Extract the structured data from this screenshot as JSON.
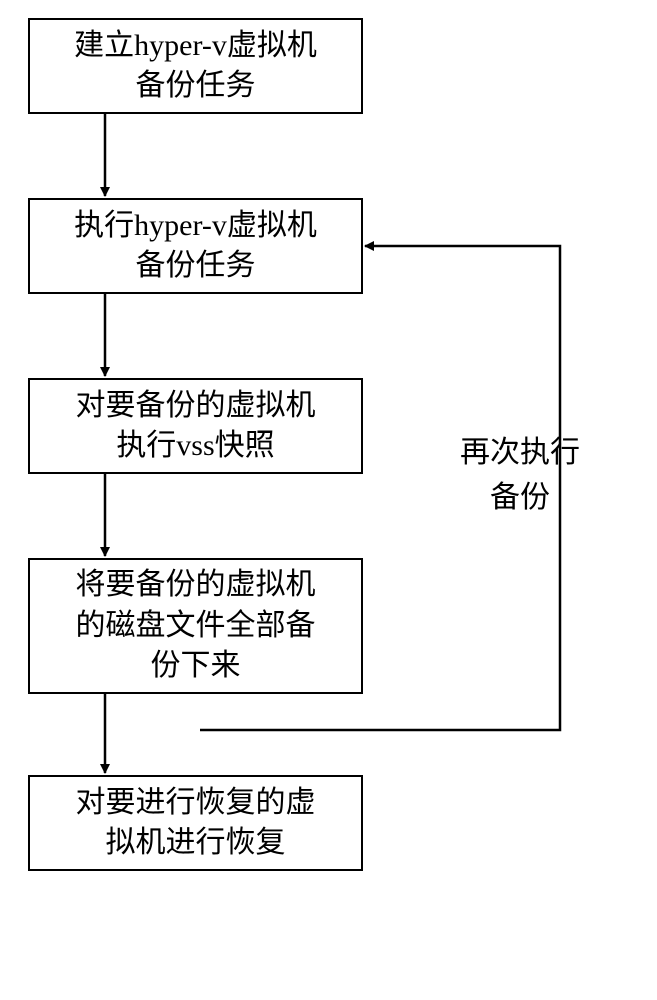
{
  "chart_data": {
    "type": "flowchart",
    "title": "",
    "nodes": [
      {
        "id": "n1",
        "label": "建立hyper-v虚拟机备份任务"
      },
      {
        "id": "n2",
        "label": "执行hyper-v虚拟机备份任务"
      },
      {
        "id": "n3",
        "label": "对要备份的虚拟机执行vss快照"
      },
      {
        "id": "n4",
        "label": "将要备份的虚拟机的磁盘文件全部备份下来"
      },
      {
        "id": "n5",
        "label": "对要进行恢复的虚拟机进行恢复"
      }
    ],
    "edges": [
      {
        "from": "n1",
        "to": "n2"
      },
      {
        "from": "n2",
        "to": "n3"
      },
      {
        "from": "n3",
        "to": "n4"
      },
      {
        "from": "n4",
        "to": "n5"
      },
      {
        "from": "n4",
        "to": "n2",
        "label": "再次执行备份"
      }
    ]
  },
  "nodes": {
    "n1": "建立hyper-v虚拟机\n备份任务",
    "n2": "执行hyper-v虚拟机\n备份任务",
    "n3": "对要备份的虚拟机\n执行vss快照",
    "n4": "将要备份的虚拟机\n的磁盘文件全部备\n份下来",
    "n5": "对要进行恢复的虚\n拟机进行恢复"
  },
  "edgeLabels": {
    "loop": "再次执行\n备份"
  }
}
